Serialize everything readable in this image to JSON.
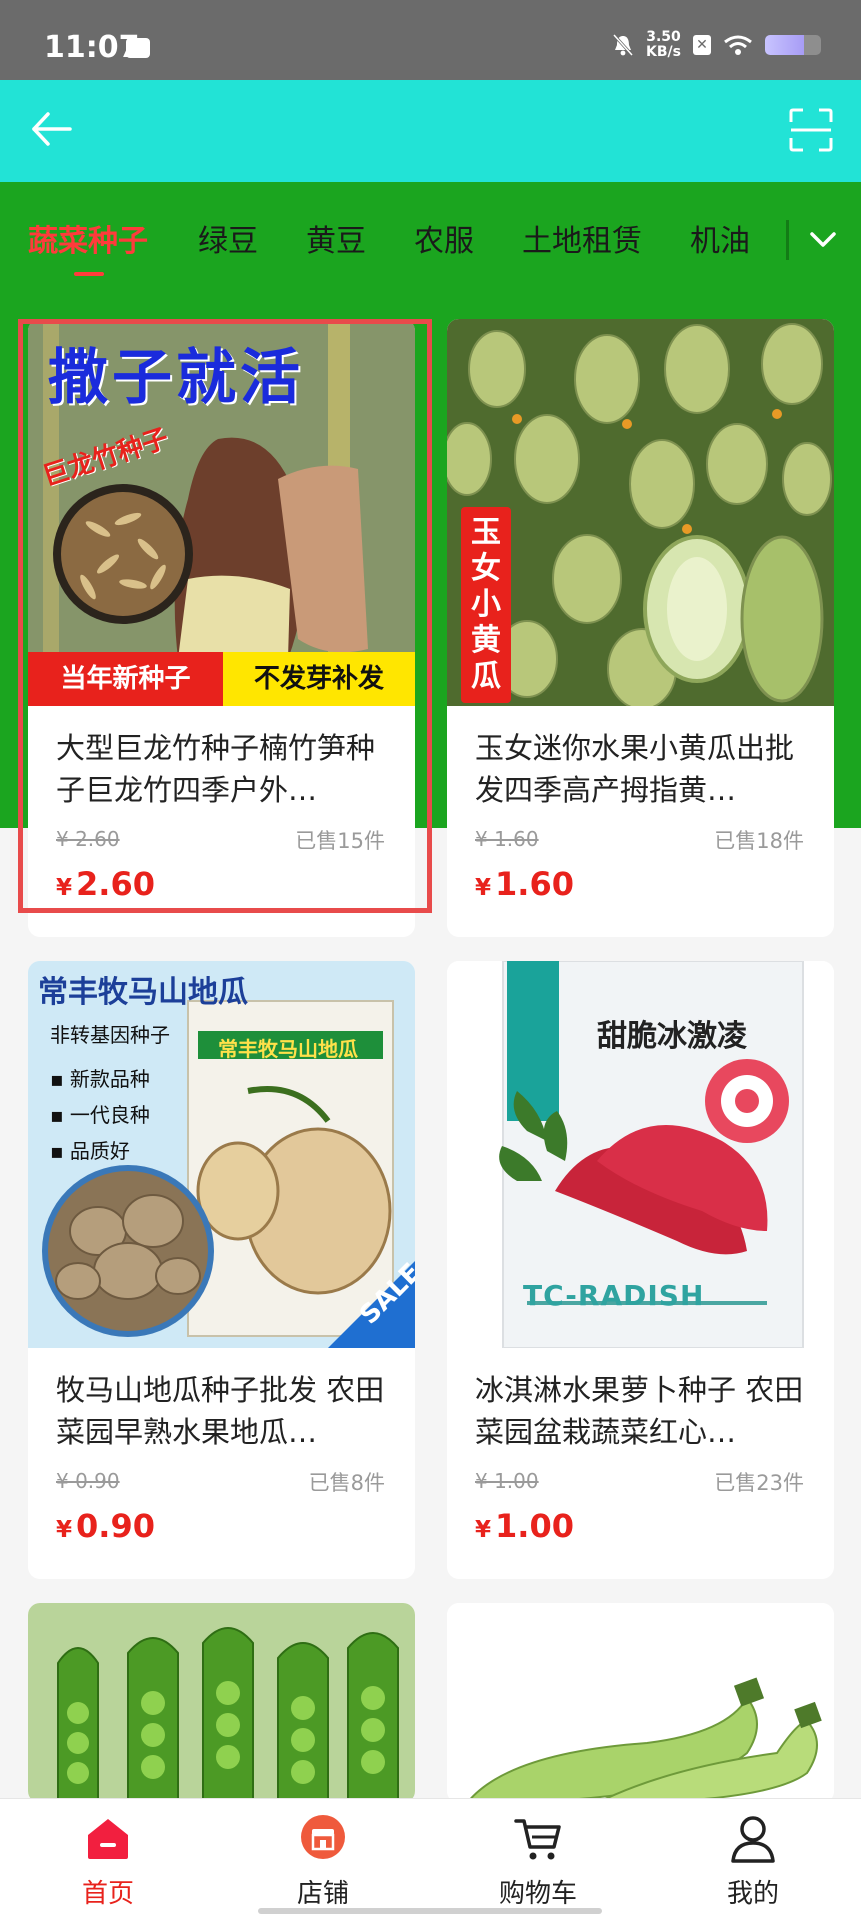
{
  "status_bar": {
    "time": "11:07",
    "net_speed_value": "3.50",
    "net_speed_unit": "KB/s"
  },
  "categories": [
    {
      "label": "蔬菜种子",
      "active": true
    },
    {
      "label": "绿豆",
      "active": false
    },
    {
      "label": "黄豆",
      "active": false
    },
    {
      "label": "农服",
      "active": false
    },
    {
      "label": "土地租赁",
      "active": false
    },
    {
      "label": "机油",
      "active": false
    }
  ],
  "products": [
    {
      "image_text_main": "撒子就活",
      "image_text_side": "巨龙竹种子",
      "image_banner_left": "当年新种子",
      "image_banner_right": "不发芽补发",
      "title": "大型巨龙竹种子楠竹笋种子巨龙竹四季户外…",
      "old_price": "¥ 2.60",
      "sold": "已售15件",
      "currency": "¥",
      "price": "2.60"
    },
    {
      "image_tag": "玉女小黄瓜",
      "title": "玉女迷你水果小黄瓜出批发四季高产拇指黄…",
      "old_price": "¥ 1.60",
      "sold": "已售18件",
      "currency": "¥",
      "price": "1.60"
    },
    {
      "image_heading": "常丰牧马山地瓜",
      "image_sub": "非转基因种子",
      "image_bullets": [
        "新款品种",
        "一代良种",
        "品质好"
      ],
      "image_packet_title": "常丰牧马山地瓜",
      "image_sale": "SALE",
      "title": "牧马山地瓜种子批发 农田菜园早熟水果地瓜…",
      "old_price": "¥ 0.90",
      "sold": "已售8件",
      "currency": "¥",
      "price": "0.90"
    },
    {
      "image_heading": "甜脆冰激凌",
      "image_brand": "TC-RADISH",
      "title": "冰淇淋水果萝卜种子 农田菜园盆栽蔬菜红心…",
      "old_price": "¥ 1.00",
      "sold": "已售23件",
      "currency": "¥",
      "price": "1.00"
    }
  ],
  "bottom_nav": [
    {
      "label": "首页",
      "icon": "home-icon",
      "active": true
    },
    {
      "label": "店铺",
      "icon": "shop-icon",
      "active": false
    },
    {
      "label": "购物车",
      "icon": "cart-icon",
      "active": false
    },
    {
      "label": "我的",
      "icon": "profile-icon",
      "active": false
    }
  ],
  "colors": {
    "header": "#22e3d6",
    "band": "#1ba51f",
    "accent": "#e8221c"
  }
}
